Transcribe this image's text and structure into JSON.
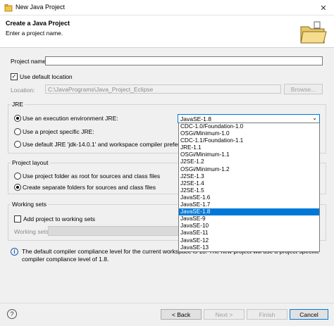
{
  "window": {
    "title": "New Java Project",
    "close_glyph": "✕"
  },
  "banner": {
    "title": "Create a Java Project",
    "subtitle": "Enter a project name."
  },
  "project_name": {
    "label": "Project name:",
    "value": ""
  },
  "default_location": {
    "label": "Use default location",
    "checked": true,
    "glyph": "✓"
  },
  "location": {
    "label": "Location:",
    "value": "C:\\JavaPrograms\\Java_Project_Eclipse",
    "browse_label": "Browse..."
  },
  "jre": {
    "group_title": "JRE",
    "options": [
      {
        "label": "Use an execution environment JRE:",
        "selected": true
      },
      {
        "label": "Use a project specific JRE:",
        "selected": false
      },
      {
        "label": "Use default JRE 'jdk-14.0.1' and workspace compiler preferences",
        "selected": false
      }
    ],
    "combo_value": "JavaSE-1.8",
    "dropdown_items": [
      "CDC-1.0/Foundation-1.0",
      "OSGi/Minimum-1.0",
      "CDC-1.1/Foundation-1.1",
      "JRE-1.1",
      "OSGi/Minimum-1.1",
      "J2SE-1.2",
      "OSGi/Minimum-1.2",
      "J2SE-1.3",
      "J2SE-1.4",
      "J2SE-1.5",
      "JavaSE-1.6",
      "JavaSE-1.7",
      "JavaSE-1.8",
      "JavaSE-9",
      "JavaSE-10",
      "JavaSE-11",
      "JavaSE-12",
      "JavaSE-13"
    ],
    "selected_item": "JavaSE-1.8"
  },
  "layout": {
    "group_title": "Project layout",
    "options": [
      {
        "label": "Use project folder as root for sources and class files",
        "selected": false
      },
      {
        "label": "Create separate folders for sources and class files",
        "selected": true
      }
    ]
  },
  "working_sets": {
    "group_title": "Working sets",
    "add_label": "Add project to working sets",
    "add_checked": false,
    "field_label": "Working sets:"
  },
  "info": {
    "glyph": "i",
    "message": "The default compiler compliance level for the current workspace is 13. The new project will use a project specific compiler compliance level of 1.8."
  },
  "footer": {
    "help_glyph": "?",
    "back_label": "< Back",
    "next_label": "Next >",
    "finish_label": "Finish",
    "cancel_label": "Cancel"
  }
}
